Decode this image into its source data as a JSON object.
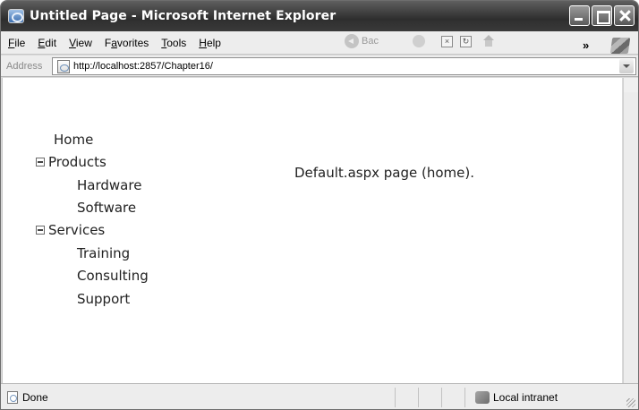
{
  "window": {
    "title": "Untitled Page - Microsoft Internet Explorer"
  },
  "menu": {
    "items": [
      {
        "label": "File",
        "accel": "F",
        "rest": "ile"
      },
      {
        "label": "Edit",
        "accel": "E",
        "rest": "dit"
      },
      {
        "label": "View",
        "accel": "V",
        "rest": "iew"
      },
      {
        "label": "Favorites",
        "accel_prefix": "F",
        "accel": "a",
        "rest": "vorites"
      },
      {
        "label": "Tools",
        "accel": "T",
        "rest": "ools"
      },
      {
        "label": "Help",
        "accel": "H",
        "rest": "elp"
      }
    ],
    "back_label": "Bac"
  },
  "address": {
    "label": "Address",
    "url": "http://localhost:2857/Chapter16/"
  },
  "tree": {
    "home": "Home",
    "products": "Products",
    "hardware": "Hardware",
    "software": "Software",
    "services": "Services",
    "training": "Training",
    "consulting": "Consulting",
    "support": "Support"
  },
  "main": {
    "page_text": "Default.aspx page (home)."
  },
  "status": {
    "text": "Done",
    "zone": "Local intranet"
  }
}
